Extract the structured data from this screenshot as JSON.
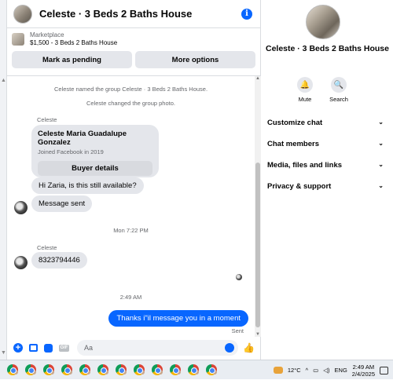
{
  "chat": {
    "title": "Celeste · 3 Beds 2 Baths House",
    "marketplace_label": "Marketplace",
    "listing": "$1,500 - 3 Beds 2 Baths House",
    "mark_pending": "Mark as pending",
    "more_options": "More options"
  },
  "messages": {
    "sys1": "Celeste named the group Celeste · 3 Beds 2 Baths House.",
    "sys2": "Celeste changed the group photo.",
    "sender1": "Celeste",
    "card_name": "Celeste Maria Guadalupe Gonzalez",
    "card_sub": "Joined Facebook in 2019",
    "buyer_details": "Buyer details",
    "msg1": "Hi Zaria, is this still available?",
    "msg2": "Message sent",
    "time1": "Mon 7:22 PM",
    "sender2": "Celeste",
    "msg3": "8323794446",
    "time2": "2:49 AM",
    "outgoing": "Thanks i\"il message you in a moment",
    "sent": "Sent"
  },
  "composer": {
    "placeholder": "Aa"
  },
  "right_panel": {
    "title": "Celeste · 3 Beds 2 Baths House",
    "mute": "Mute",
    "search": "Search",
    "menu": [
      "Customize chat",
      "Chat members",
      "Media, files and links",
      "Privacy & support"
    ]
  },
  "taskbar": {
    "temp": "12°C",
    "lang": "ENG",
    "time": "2:49 AM",
    "date": "2/4/2025"
  },
  "colors": {
    "accent": "#0866ff",
    "bubble": "#e4e6eb"
  }
}
